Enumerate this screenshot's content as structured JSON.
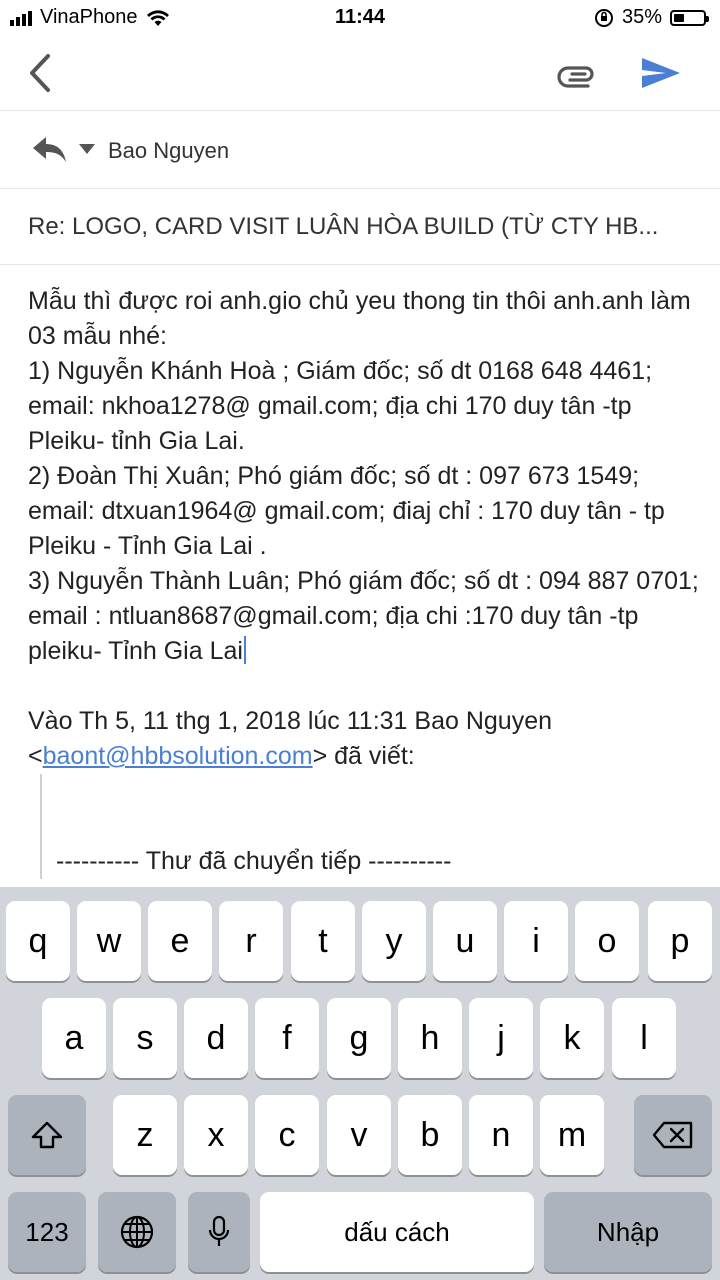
{
  "status_bar": {
    "carrier": "VinaPhone",
    "time": "11:44",
    "battery_percent": "35%",
    "battery_level": 0.35
  },
  "toolbar": {
    "back_icon": "chevron-left-icon",
    "attach_icon": "paperclip-icon",
    "send_icon": "send-icon",
    "accent_color": "#4a7fd4"
  },
  "from": {
    "name": "Bao Nguyen",
    "reply_icon": "reply-icon"
  },
  "subject": "Re: LOGO, CARD VISIT LUÂN HÒA BUILD (TỪ CTY HB...",
  "body": {
    "lines": [
      "Mẫu thì được roi anh.gio chủ yeu thong tin thôi anh.anh làm 03 mẫu nhé:",
      "1) Nguyễn Khánh Hoà ; Giám đốc; số dt 0168 648 4461; email: nkhoa1278@ gmail.com; địa chi 170 duy tân -tp Pleiku- tỉnh Gia Lai.",
      "2) Đoàn Thị Xuân; Phó giám đốc; số dt : 097 673 1549; email: dtxuan1964@ gmail.com; điaj chỉ : 170 duy tân - tp Pleiku - Tỉnh Gia Lai .",
      "3) Nguyễn Thành Luân; Phó giám đốc; số dt : 094 887 0701; email : ntluan8687@gmail.com; địa chi :170 duy tân -tp pleiku- Tỉnh Gia Lai"
    ],
    "quote_intro": "Vào Th 5, 11 thg 1, 2018 lúc 11:31 Bao Nguyen <",
    "quote_email": "baont@hbbsolution.com",
    "quote_after": "> đã viết:",
    "forwarded": "---------- Thư đã chuyển tiếp ----------"
  },
  "keyboard": {
    "row1": [
      "q",
      "w",
      "e",
      "r",
      "t",
      "y",
      "u",
      "i",
      "o",
      "p"
    ],
    "row2": [
      "a",
      "s",
      "d",
      "f",
      "g",
      "h",
      "j",
      "k",
      "l"
    ],
    "row3": [
      "z",
      "x",
      "c",
      "v",
      "b",
      "n",
      "m"
    ],
    "num_key": "123",
    "space_key": "dấu cách",
    "return_key": "Nhập",
    "shift_icon": "shift-icon",
    "delete_icon": "backspace-icon",
    "globe_icon": "globe-icon",
    "mic_icon": "microphone-icon"
  }
}
